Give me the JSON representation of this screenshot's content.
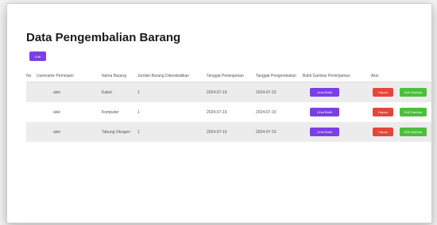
{
  "page": {
    "title": "Data Pengembalian Barang",
    "add_label": "Edit"
  },
  "table": {
    "headers": {
      "no": "No",
      "username": "Username Peminjam",
      "nama_barang": "Nama Barang",
      "jumlah": "Jumlah Barang Dikembalikan",
      "tgl_peminjaman": "Tanggal Peminjaman",
      "tgl_pengembalian": "Tanggal Pengembalian",
      "bukti": "Bukti Gambar Peminjaman",
      "aksi": "Aksi"
    },
    "rows": [
      {
        "username": "alwi",
        "nama_barang": "Kabel",
        "jumlah": "1",
        "tgl_peminjaman": "2024-07-19",
        "tgl_pengembalian": "2024-07-19",
        "bukti_label": "Lihat Bukti",
        "hapus_label": "Hapus",
        "edit_label": "Edit Gambar"
      },
      {
        "username": "alwi",
        "nama_barang": "Komputer",
        "jumlah": "1",
        "tgl_peminjaman": "2024-07-19",
        "tgl_pengembalian": "2024-07-19",
        "bukti_label": "Lihat Bukti",
        "hapus_label": "Hapus",
        "edit_label": "Edit Gambar"
      },
      {
        "username": "alwi",
        "nama_barang": "Tabung Oksigen",
        "jumlah": "1",
        "tgl_peminjaman": "2024-07-19",
        "tgl_pengembalian": "2024-07-19",
        "bukti_label": "Lihat Bukti",
        "hapus_label": "Hapus",
        "edit_label": "Edit Gambar"
      }
    ]
  },
  "colors": {
    "primary": "#7b3fe4",
    "danger": "#e4463c",
    "success": "#4cbf3b"
  }
}
